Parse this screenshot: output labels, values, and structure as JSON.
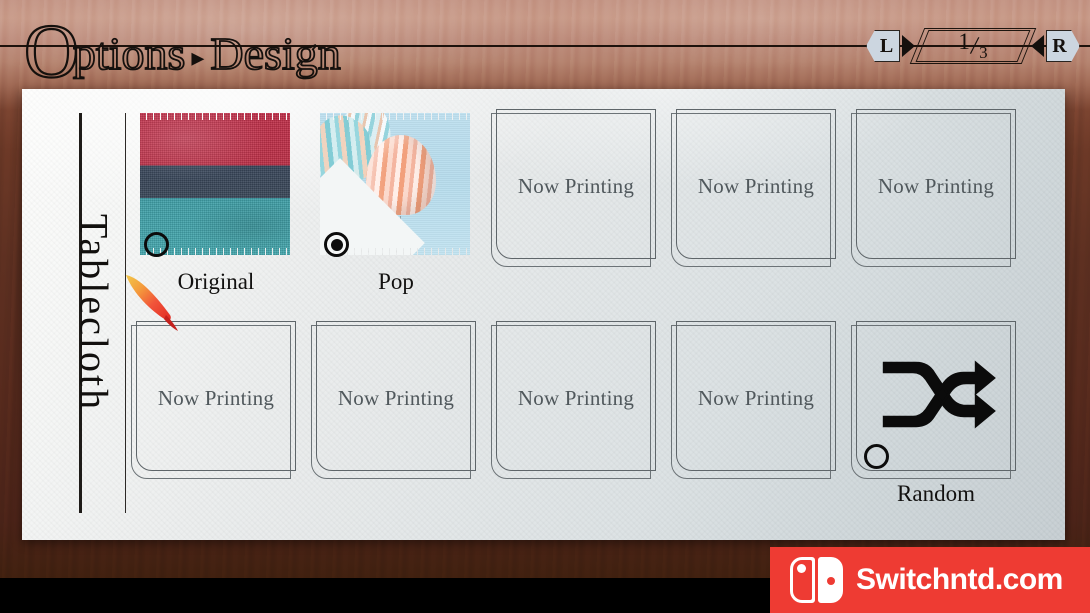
{
  "header": {
    "title_initial": "O",
    "title_rest": "ptions",
    "separator": "▸",
    "title_section": "Design",
    "title_full": "Options ▸ Design"
  },
  "pager": {
    "left_button": "L",
    "right_button": "R",
    "current_page": "1",
    "slash": "/",
    "total_pages": "3",
    "left_arrow_icon": "triangle-left-icon",
    "right_arrow_icon": "triangle-right-icon"
  },
  "category": {
    "label": "Tablecloth"
  },
  "colors": {
    "wood_light": "#c49585",
    "wood_dark": "#40200f",
    "paper_light": "#fdfdfc",
    "paper_dark": "#c6ced2",
    "ink": "#12100e",
    "placeholder_text": "#50585c",
    "watermark_red": "#ee3b33"
  },
  "grid": {
    "row1": [
      {
        "id": "original",
        "type": "swatch",
        "pattern": "original-fabric",
        "label": "Original",
        "selected": false,
        "has_radio": true
      },
      {
        "id": "pop",
        "type": "swatch",
        "pattern": "pop-balloons",
        "label": "Pop",
        "selected": true,
        "has_radio": true
      },
      {
        "id": "slot-3",
        "type": "placeholder",
        "label": "Now Printing",
        "selected": false,
        "has_radio": false
      },
      {
        "id": "slot-4",
        "type": "placeholder",
        "label": "Now Printing",
        "selected": false,
        "has_radio": false
      },
      {
        "id": "slot-5",
        "type": "placeholder",
        "label": "Now Printing",
        "selected": false,
        "has_radio": false
      }
    ],
    "row2": [
      {
        "id": "slot-6",
        "type": "placeholder",
        "label": "Now Printing",
        "selected": false,
        "has_radio": false
      },
      {
        "id": "slot-7",
        "type": "placeholder",
        "label": "Now Printing",
        "selected": false,
        "has_radio": false
      },
      {
        "id": "slot-8",
        "type": "placeholder",
        "label": "Now Printing",
        "selected": false,
        "has_radio": false
      },
      {
        "id": "slot-9",
        "type": "placeholder",
        "label": "Now Printing",
        "selected": false,
        "has_radio": false
      },
      {
        "id": "random",
        "type": "random",
        "icon": "shuffle-icon",
        "label": "Random",
        "selected": false,
        "has_radio": true
      }
    ]
  },
  "cursor": {
    "icon": "brush-pointer-icon"
  },
  "watermark": {
    "text": "Switchntd.com",
    "logo_icon": "nintendo-switch-icon"
  }
}
